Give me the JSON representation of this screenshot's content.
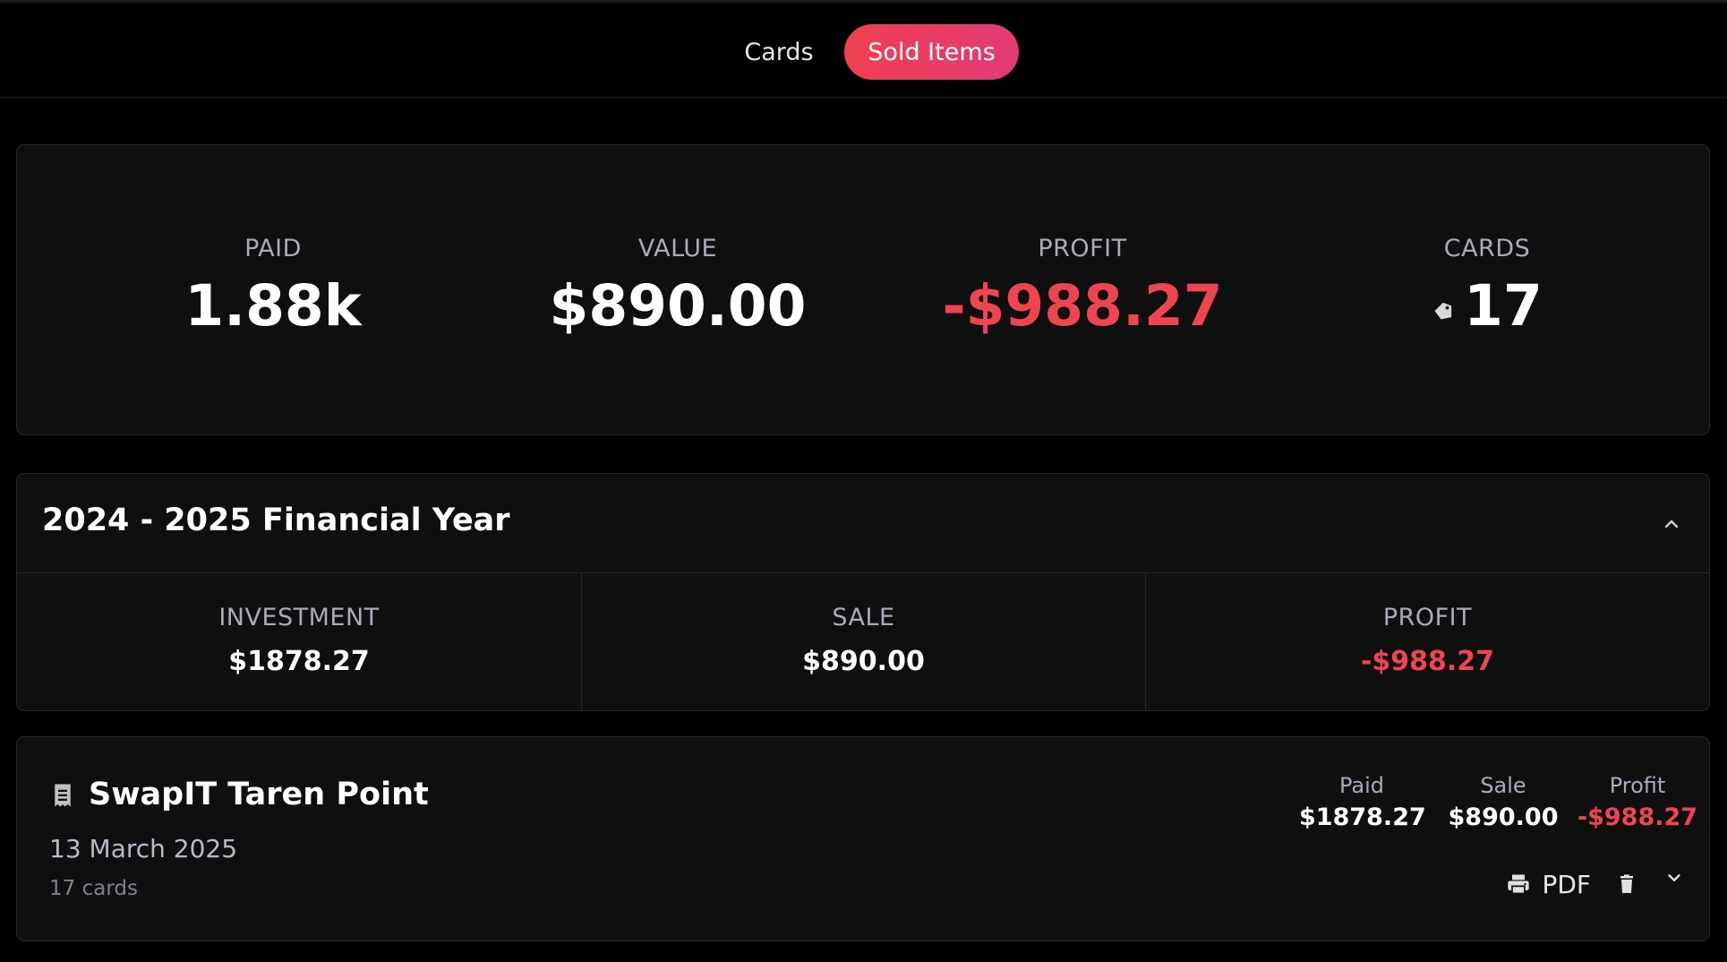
{
  "nav": {
    "tabs": [
      {
        "label": "Cards",
        "active": false
      },
      {
        "label": "Sold Items",
        "active": true
      }
    ],
    "active_gradient": [
      "#f04050",
      "#e23a78"
    ]
  },
  "summary": {
    "paid": {
      "label": "PAID",
      "value": "1.88k"
    },
    "value": {
      "label": "VALUE",
      "value": "$890.00"
    },
    "profit": {
      "label": "PROFIT",
      "value": "-$988.27",
      "color": "#ef4550"
    },
    "cards": {
      "label": "CARDS",
      "value": "17",
      "icon": "tag-icon"
    }
  },
  "financial_year": {
    "title": "2024 - 2025 Financial Year",
    "expanded": true,
    "toggle_icon": "chevron-up-icon",
    "columns": [
      {
        "label": "INVESTMENT",
        "value": "$1878.27"
      },
      {
        "label": "SALE",
        "value": "$890.00"
      },
      {
        "label": "PROFIT",
        "value": "-$988.27",
        "color": "#ef4550"
      }
    ]
  },
  "sales": [
    {
      "icon": "receipt-icon",
      "name": "SwapIT Taren Point",
      "date": "13 March 2025",
      "count": "17 cards",
      "paid_label": "Paid",
      "paid": "$1878.27",
      "sale_label": "Sale",
      "sale": "$890.00",
      "profit_label": "Profit",
      "profit": "-$988.27",
      "actions": {
        "pdf_label": "PDF",
        "print_icon": "print-icon",
        "delete_icon": "trash-icon",
        "expand_icon": "chevron-down-icon"
      }
    }
  ]
}
